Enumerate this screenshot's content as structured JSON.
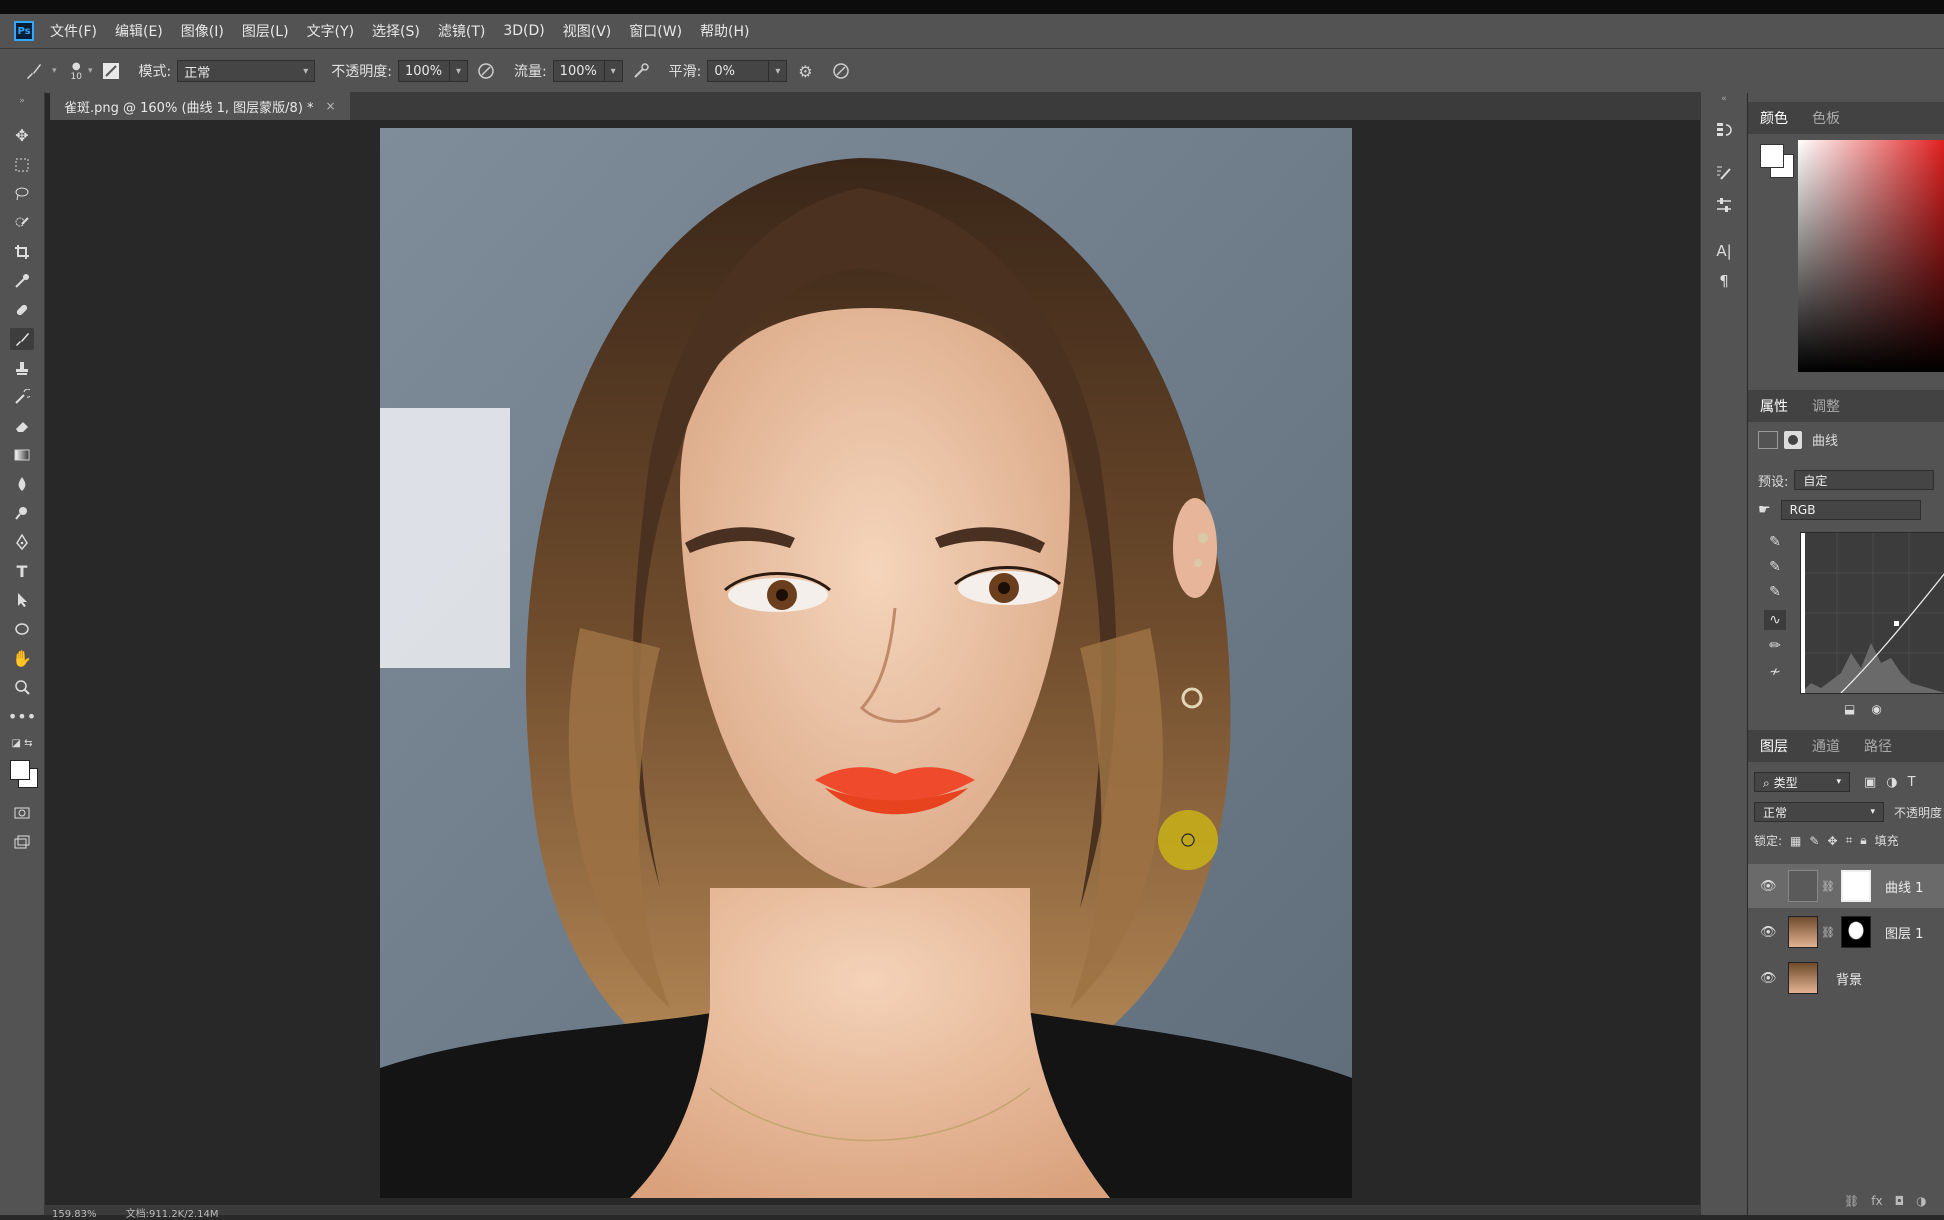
{
  "app": {
    "logo": "Ps"
  },
  "menu": [
    "文件(F)",
    "编辑(E)",
    "图像(I)",
    "图层(L)",
    "文字(Y)",
    "选择(S)",
    "滤镜(T)",
    "3D(D)",
    "视图(V)",
    "窗口(W)",
    "帮助(H)"
  ],
  "options": {
    "brush_size": "10",
    "mode_label": "模式:",
    "mode_value": "正常",
    "opacity_label": "不透明度:",
    "opacity_value": "100%",
    "flow_label": "流量:",
    "flow_value": "100%",
    "smooth_label": "平滑:",
    "smooth_value": "0%"
  },
  "document_tab": {
    "title": "雀斑.png @ 160% (曲线 1, 图层蒙版/8) *",
    "close": "×"
  },
  "status": {
    "zoom": "159.83%",
    "doc": "文档:911.2K/2.14M"
  },
  "color_panel": {
    "tabs": [
      "颜色",
      "色板"
    ],
    "fg": "#ffffff",
    "bg": "#ffffff"
  },
  "properties_panel": {
    "tabs": [
      "属性",
      "调整"
    ],
    "title": "曲线",
    "preset_label": "预设:",
    "preset_value": "自定",
    "channel_value": "RGB"
  },
  "layers_panel": {
    "tabs": [
      "图层",
      "通道",
      "路径"
    ],
    "filter_kind": "类型",
    "blend_mode": "正常",
    "opacity_label": "不透明度",
    "lock_label": "锁定:",
    "fill_label": "填充",
    "layers": [
      {
        "name": "曲线 1",
        "selected": true
      },
      {
        "name": "图层 1",
        "selected": false
      },
      {
        "name": "背景",
        "selected": false
      }
    ]
  }
}
